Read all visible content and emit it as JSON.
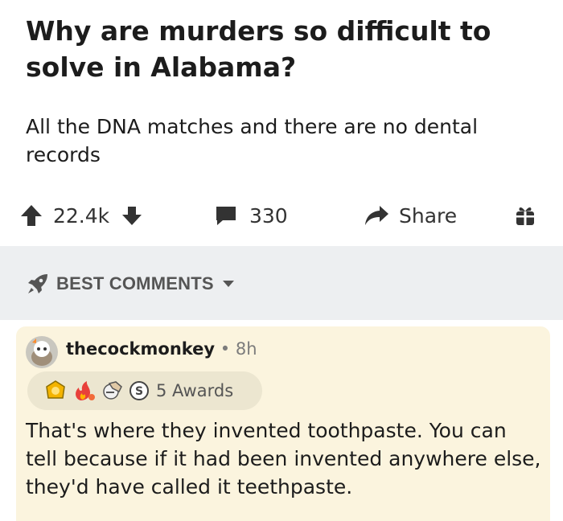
{
  "post": {
    "title": "Why are murders so difficult to solve in Alabama?",
    "body": "All the DNA matches and there are no dental records"
  },
  "actions": {
    "score": "22.4k",
    "comments": "330",
    "share": "Share",
    "icons": [
      "upvote-icon",
      "downvote-icon",
      "comment-icon",
      "share-icon",
      "award-gift-icon"
    ]
  },
  "sort": {
    "label": "BEST COMMENTS",
    "icon": "rocket-icon"
  },
  "comment": {
    "username": "thecockmonkey",
    "time": "8h",
    "awards_label": "5 Awards",
    "award_icons": [
      "wholesome-award-icon",
      "fire-award-icon",
      "facepalm-award-icon",
      "silver-award-icon"
    ],
    "text": "That's where they invented toothpaste. You can tell because if it had been invented anywhere else, they'd have called it teethpaste."
  },
  "colors": {
    "comment_highlight": "#fbf4de",
    "sort_bar": "#edeff1",
    "text": "#1c1c1c"
  }
}
